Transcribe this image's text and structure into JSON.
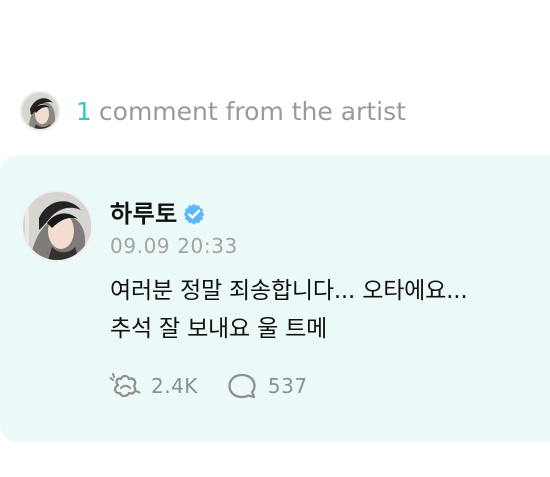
{
  "header": {
    "count": "1",
    "label": "comment from the artist",
    "avatar_icon": "artist-avatar"
  },
  "comment": {
    "artist_name": "하루토",
    "verified_icon": "verified-badge-icon",
    "timestamp": "09.09 20:33",
    "lines": [
      "여러분 정말 죄송합니다... 오타에요...",
      "추석 잘 보내요 울 트메"
    ],
    "stats": {
      "reaction_icon": "reaction-icon",
      "reaction_count": "2.4K",
      "reply_icon": "comment-bubble-icon",
      "reply_count": "537"
    }
  },
  "colors": {
    "accent": "#37c7c3",
    "card_background": "#ebf9f8",
    "muted_text": "#9a9a9a",
    "verified": "#5db7ff"
  }
}
